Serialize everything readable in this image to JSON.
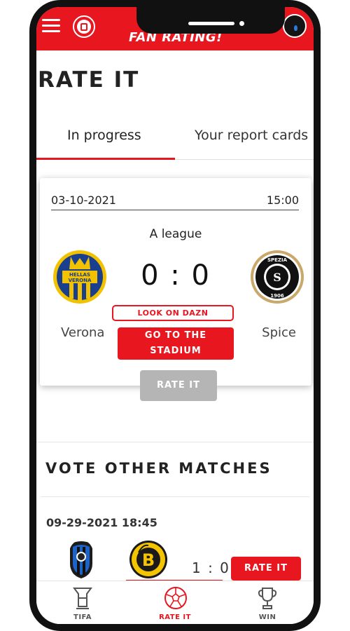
{
  "app": {
    "title": "FAN RATING!",
    "brand_color": "#e8161f",
    "icons": [
      "menu-icon",
      "app-logo-icon",
      "bell-icon",
      "avatar"
    ]
  },
  "page": {
    "title": "RATE IT"
  },
  "tabs": [
    {
      "label": "In progress",
      "active": true
    },
    {
      "label": "Your report cards",
      "active": false
    }
  ],
  "featured_match": {
    "date": "03-10-2021",
    "time": "15:00",
    "league": "A league",
    "score": "0 : 0",
    "home_team": "Verona",
    "away_team": "Spice",
    "home_crest_text": "HELLAS VERONA",
    "away_crest_text": "SPEZIA 1906",
    "watch_label": "LOOK ON DAZN",
    "stadium_label": "GO TO THE STADIUM",
    "rate_label": "RATE IT",
    "rate_enabled": false
  },
  "other_matches": {
    "title": "VOTE OTHER MATCHES",
    "items": [
      {
        "datetime": "09-29-2021 18:45",
        "home_crest": "atalanta-crest",
        "away_crest": "young-boys-crest",
        "score": "1 : 0",
        "rate_label": "RATE IT"
      }
    ]
  },
  "bottom_nav": [
    {
      "label": "TIFA",
      "icon": "tifa-icon",
      "active": false
    },
    {
      "label": "RATE IT",
      "icon": "ball-icon",
      "active": true
    },
    {
      "label": "WIN",
      "icon": "trophy-icon",
      "active": false
    }
  ]
}
